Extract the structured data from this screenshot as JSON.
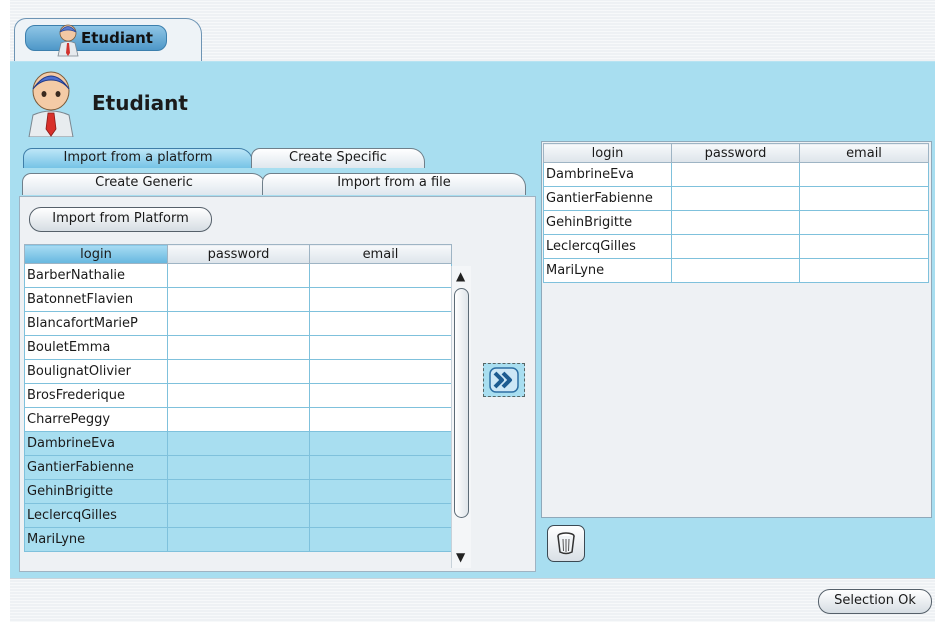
{
  "header": {
    "tab_label": "Etudiant",
    "title": "Etudiant"
  },
  "subtabs": {
    "import_platform": "Import from a platform",
    "create_specific": "Create Specific",
    "create_generic": "Create Generic",
    "import_file": "Import from a file"
  },
  "left": {
    "import_button": "Import from Platform",
    "columns": {
      "login": "login",
      "password": "password",
      "email": "email"
    },
    "rows": [
      "BarberNathalie",
      "BatonnetFlavien",
      "BlancafortMarieP",
      "BouletEmma",
      "BoulignatOlivier",
      "BrosFrederique",
      "CharrePeggy",
      "DambrineEva",
      "GantierFabienne",
      "GehinBrigitte",
      "LeclercqGilles",
      "MariLyne"
    ]
  },
  "right": {
    "columns": {
      "login": "login",
      "password": "password",
      "email": "email"
    },
    "rows": [
      "DambrineEva",
      "GantierFabienne",
      "GehinBrigitte",
      "LeclercqGilles",
      "MariLyne"
    ]
  },
  "footer": {
    "ok_button": "Selection Ok"
  },
  "colors": {
    "panel_bg": "#a8def0",
    "active_tab": "#76c3e6",
    "selected_row": "#a8def0"
  },
  "icons": {
    "person": "person-icon",
    "move_right": "double-chevron-right-icon",
    "trash": "trash-icon",
    "scroll_up": "chevron-up-icon",
    "scroll_down": "chevron-down-icon"
  }
}
